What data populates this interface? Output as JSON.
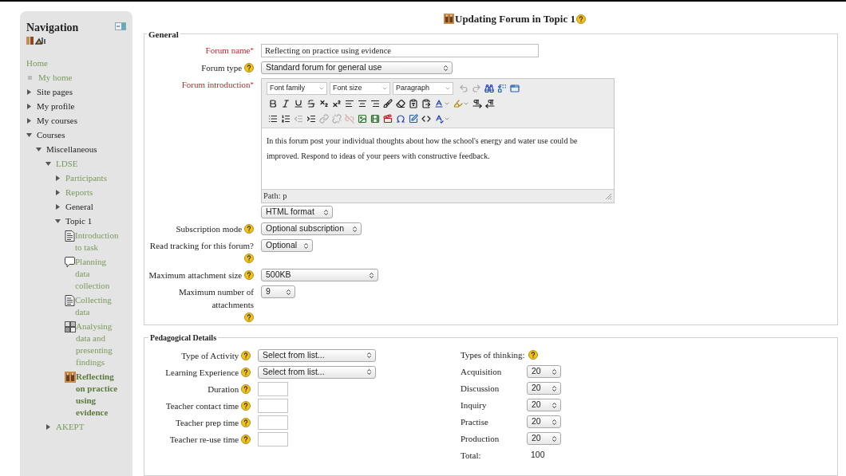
{
  "navigation": {
    "title": "Navigation",
    "items": [
      {
        "label": "Home",
        "kind": "link"
      },
      {
        "label": "My home",
        "kind": "bullet"
      },
      {
        "label": "Site pages",
        "kind": "branch",
        "expanded": false
      },
      {
        "label": "My profile",
        "kind": "branch",
        "expanded": false
      },
      {
        "label": "My courses",
        "kind": "branch",
        "expanded": false
      },
      {
        "label": "Courses",
        "kind": "branch",
        "expanded": true,
        "children": [
          {
            "label": "Miscellaneous",
            "kind": "branch",
            "expanded": true,
            "children": [
              {
                "label": "LDSE",
                "kind": "branch_link",
                "expanded": true,
                "children": [
                  {
                    "label": "Participants",
                    "kind": "branch_link",
                    "expanded": false
                  },
                  {
                    "label": "Reports",
                    "kind": "branch_link",
                    "expanded": false
                  },
                  {
                    "label": "General",
                    "kind": "branch",
                    "expanded": false
                  },
                  {
                    "label": "Topic 1",
                    "kind": "branch",
                    "expanded": true,
                    "children": [
                      {
                        "label": "Introduction to task",
                        "kind": "page",
                        "selected": false
                      },
                      {
                        "label": "Planning data collection",
                        "kind": "chat",
                        "selected": false
                      },
                      {
                        "label": "Collecting data",
                        "kind": "page",
                        "selected": false
                      },
                      {
                        "label": "Analysing data and presenting findings",
                        "kind": "workshop",
                        "selected": false
                      },
                      {
                        "label": "Reflecting on practice using evidence",
                        "kind": "forum",
                        "selected": true
                      }
                    ]
                  }
                ]
              },
              {
                "label": "AKEPT",
                "kind": "branch_link",
                "expanded": false
              }
            ]
          }
        ]
      }
    ]
  },
  "heading": {
    "title": "Updating Forum in Topic 1"
  },
  "general": {
    "legend": "General",
    "fields": [
      {
        "label": "Forum name",
        "asterisk": "*",
        "help": false,
        "kind": "text",
        "value": "Reflecting on practice using evidence"
      },
      {
        "label": "Forum type",
        "help": true,
        "kind": "select",
        "value": "Standard forum for general use"
      },
      {
        "label": "Forum introduction",
        "asterisk": "*",
        "help": false,
        "kind": "editor",
        "editor": {
          "font_family": "Font family",
          "font_size": "Font size",
          "block_format": "Paragraph",
          "toolbar": [
            [
              {
                "disabled": true
              },
              {
                "disabled": true
              },
              {
                "disabled": false
              },
              {
                "disabled": false
              },
              {
                "disabled": false
              }
            ],
            [
              {
                "disabled": false
              },
              {
                "disabled": false
              },
              {
                "disabled": false
              },
              {
                "disabled": false
              },
              {
                "disabled": false
              },
              {
                "disabled": false
              },
              {
                "disabled": false
              },
              {
                "disabled": false
              },
              {
                "disabled": false
              },
              {
                "disabled": false
              },
              {
                "disabled": false
              },
              {
                "disabled": false
              },
              {
                "disabled": false
              },
              {
                "disabled": false
              },
              {
                "disabled": false
              },
              {
                "disabled": false
              },
              {
                "disabled": false
              }
            ],
            [
              {
                "disabled": false
              },
              {
                "disabled": false
              },
              {
                "disabled": true
              },
              {
                "disabled": false
              },
              {
                "disabled": true
              },
              {
                "disabled": true
              },
              {
                "disabled": true
              },
              {
                "disabled": false
              },
              {
                "disabled": false
              },
              {
                "disabled": false
              },
              {
                "disabled": false
              },
              {
                "disabled": false
              },
              {
                "disabled": false
              },
              {
                "disabled": false
              }
            ]
          ],
          "text": "In this forum post your individual thoughts about how the school's energy and water use could be improved. Respond to ideas of your peers with constructive feedback.",
          "path": "Path: p",
          "format": "HTML format"
        }
      },
      {
        "label": "Subscription mode",
        "help": true,
        "kind": "select",
        "value": "Optional subscription"
      },
      {
        "label": "Read tracking for this forum?",
        "help": true,
        "kind": "select",
        "value": "Optional"
      },
      {
        "label": "Maximum attachment size",
        "help": true,
        "kind": "select",
        "value": "500KB"
      },
      {
        "label": "Maximum number of attachments",
        "help": true,
        "kind": "select",
        "value": "9"
      }
    ]
  },
  "pedagogical": {
    "legend": "Pedagogical Details",
    "fields": [
      {
        "label": "Type of Activity",
        "help": true,
        "kind": "select",
        "value": "Select from list..."
      },
      {
        "label": "Learning Experience",
        "help": true,
        "kind": "select",
        "value": "Select from list..."
      },
      {
        "label": "Duration",
        "help": true,
        "kind": "text"
      },
      {
        "label": "Teacher contact time",
        "help": true,
        "kind": "text"
      },
      {
        "label": "Teacher prep time",
        "help": true,
        "kind": "text"
      },
      {
        "label": "Teacher re-use time",
        "help": true,
        "kind": "text"
      }
    ],
    "thinking": {
      "label": "Types of thinking:",
      "help": true,
      "rows": [
        {
          "label": "Acquisition",
          "value": "20"
        },
        {
          "label": "Discussion",
          "value": "20"
        },
        {
          "label": "Inquiry",
          "value": "20"
        },
        {
          "label": "Practise",
          "value": "20"
        },
        {
          "label": "Production",
          "value": "20"
        }
      ],
      "total_label": "Total:",
      "total": "100"
    }
  }
}
